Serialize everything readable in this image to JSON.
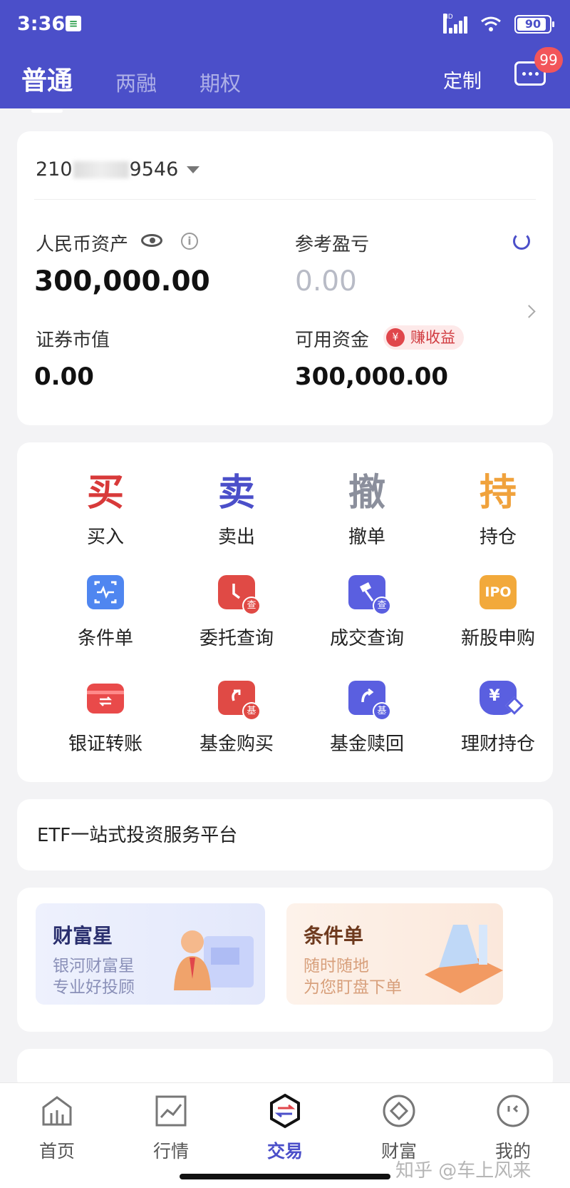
{
  "status_bar": {
    "time": "3:36",
    "hd": "HD",
    "battery": "90"
  },
  "header": {
    "tabs": [
      {
        "label": "普通",
        "active": true
      },
      {
        "label": "两融",
        "active": false
      },
      {
        "label": "期权",
        "active": false
      }
    ],
    "customize": "定制",
    "message_badge": "99"
  },
  "account": {
    "id_prefix": "210",
    "id_suffix": "9546",
    "rmb_assets_label": "人民币资产",
    "rmb_assets_value": "300,000.00",
    "ref_pl_label": "参考盈亏",
    "ref_pl_value": "0.00",
    "securities_value_label": "证券市值",
    "securities_value": "0.00",
    "available_funds_label": "可用资金",
    "available_funds_value": "300,000.00",
    "earn_tag": "赚收益",
    "yen": "¥"
  },
  "actions": {
    "big": [
      {
        "char": "买",
        "label": "买入",
        "color": "#d83a3a"
      },
      {
        "char": "卖",
        "label": "卖出",
        "color": "#4b4fc9"
      },
      {
        "char": "撤",
        "label": "撤单",
        "color": "#8b8f9c"
      },
      {
        "char": "持",
        "label": "持仓",
        "color": "#f0a23c"
      }
    ],
    "items": [
      {
        "label": "条件单",
        "icon": "scan-icon"
      },
      {
        "label": "委托查询",
        "icon": "order-query-icon",
        "sub": "查"
      },
      {
        "label": "成交查询",
        "icon": "deal-query-icon",
        "sub": "查"
      },
      {
        "label": "新股申购",
        "icon": "ipo-icon",
        "text": "IPO"
      },
      {
        "label": "银证转账",
        "icon": "bank-transfer-icon"
      },
      {
        "label": "基金购买",
        "icon": "fund-buy-icon",
        "sub": "基"
      },
      {
        "label": "基金赎回",
        "icon": "fund-redeem-icon",
        "sub": "基"
      },
      {
        "label": "理财持仓",
        "icon": "wealth-holdings-icon",
        "text": "¥"
      }
    ]
  },
  "etf": {
    "text": "ETF一站式投资服务平台"
  },
  "promos": [
    {
      "title": "财富星",
      "line1": "银河财富星",
      "line2": "专业好投顾"
    },
    {
      "title": "条件单",
      "line1": "随时随地",
      "line2": "为您盯盘下单"
    }
  ],
  "tabbar": [
    {
      "label": "首页",
      "icon": "home-icon",
      "active": false
    },
    {
      "label": "行情",
      "icon": "market-chart-icon",
      "active": false
    },
    {
      "label": "交易",
      "icon": "trade-icon",
      "active": true
    },
    {
      "label": "财富",
      "icon": "wealth-icon",
      "active": false
    },
    {
      "label": "我的",
      "icon": "profile-icon",
      "active": false
    }
  ],
  "watermark": "知乎 @车上风来"
}
